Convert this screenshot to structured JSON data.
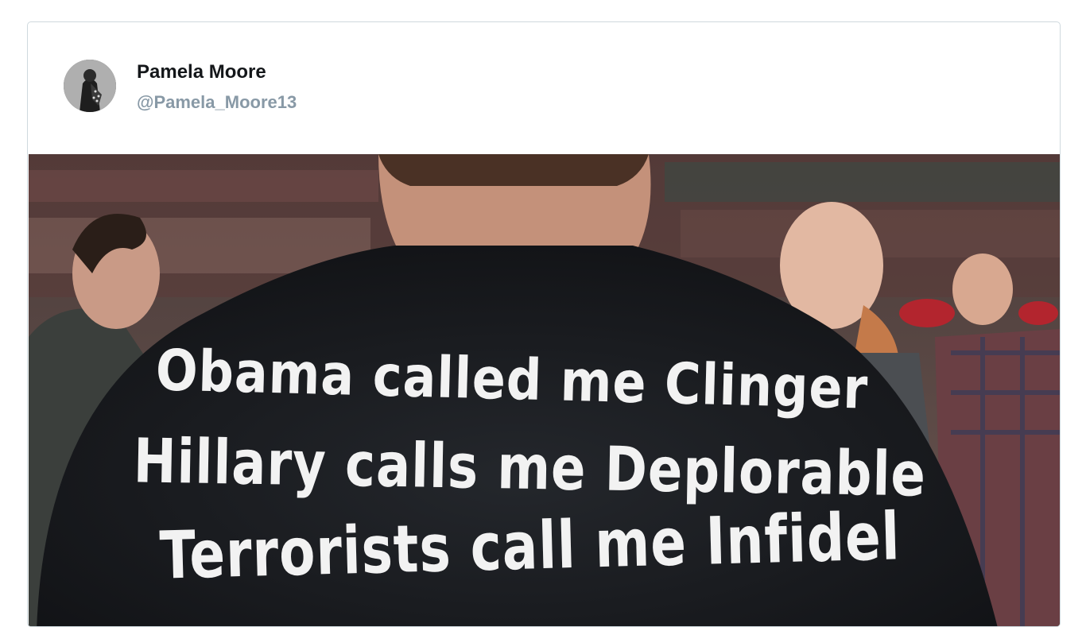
{
  "tweet": {
    "author": {
      "display_name": "Pamela Moore",
      "handle": "@Pamela_Moore13",
      "avatar_icon": "avatar-profile-picture"
    },
    "photo": {
      "shirt_text": [
        "Obama called me Clinger",
        "Hillary calls me Deplorable",
        "Terrorists call me Infidel"
      ]
    }
  },
  "colors": {
    "border": "#cfd9de",
    "name": "#14171a",
    "handle": "#8899a6",
    "shirt": "#17191d",
    "shirt_text": "#f2f2f2"
  }
}
